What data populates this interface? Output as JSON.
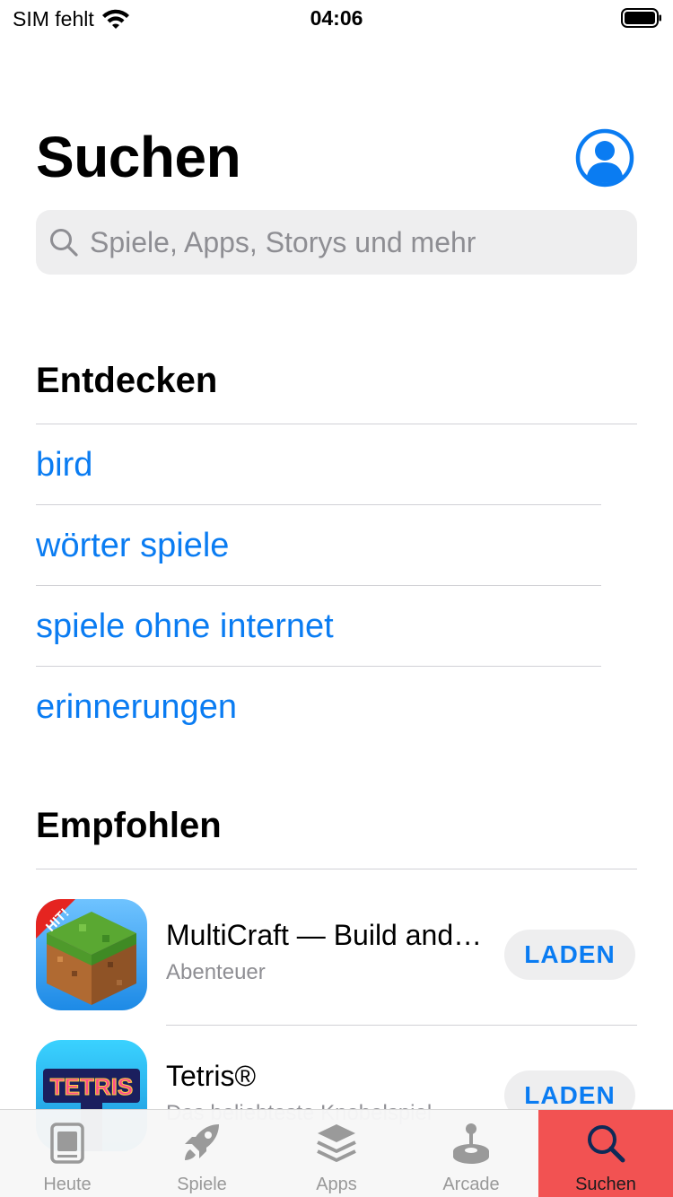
{
  "status_bar": {
    "carrier": "SIM fehlt",
    "time": "04:06"
  },
  "header": {
    "title": "Suchen"
  },
  "search": {
    "placeholder": "Spiele, Apps, Storys und mehr"
  },
  "discover": {
    "title": "Entdecken",
    "items": [
      "bird",
      "wörter spiele",
      "spiele ohne internet",
      "erinnerungen"
    ]
  },
  "recommended": {
    "title": "Empfohlen",
    "apps": [
      {
        "name": "MultiCraft — Build and Mine!",
        "subtitle": "Abenteuer",
        "button": "LADEN",
        "badge": "HIT!"
      },
      {
        "name": "Tetris®",
        "subtitle": "Das beliebteste Knobelspiel",
        "button": "LADEN",
        "logo": "TETRIS"
      }
    ]
  },
  "tab_bar": {
    "tabs": [
      {
        "label": "Heute",
        "icon": "today-icon"
      },
      {
        "label": "Spiele",
        "icon": "rocket-icon"
      },
      {
        "label": "Apps",
        "icon": "layers-icon"
      },
      {
        "label": "Arcade",
        "icon": "joystick-icon"
      },
      {
        "label": "Suchen",
        "icon": "search-icon"
      }
    ],
    "active_color": "#f25252"
  },
  "colors": {
    "accent": "#0a7cf2",
    "secondary_text": "#8e8e93"
  }
}
